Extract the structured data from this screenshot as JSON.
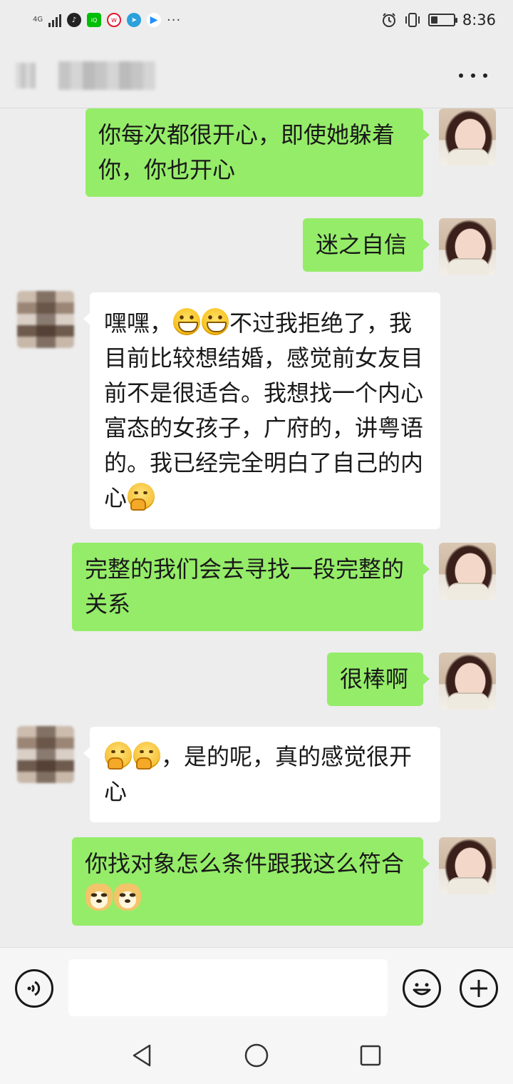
{
  "status_bar": {
    "network": "4G",
    "time": "8:36",
    "battery_level": 0.3,
    "app_icons": [
      "tiktok-icon",
      "iqiyi-icon",
      "weibo-icon",
      "telegram-icon",
      "youku-icon"
    ],
    "more": "···"
  },
  "header": {
    "title": "",
    "more_icon": "more-dots-icon"
  },
  "messages": [
    {
      "side": "me",
      "text": "你每次都很开心，即使她躲着你，你也开心"
    },
    {
      "side": "me",
      "text": "迷之自信"
    },
    {
      "side": "friend",
      "text_before": "嘿嘿，",
      "emoji": [
        "grin",
        "grin"
      ],
      "text_after": "不过我拒绝了，我目前比较想结婚，感觉前女友目前不是很适合。我想找一个内心富态的女孩子，广府的，讲粤语的。我已经完全明白了自己的内心",
      "trailing_emoji": "think"
    },
    {
      "side": "me",
      "text": "完整的我们会去寻找一段完整的关系"
    },
    {
      "side": "me",
      "text": "很棒啊"
    },
    {
      "side": "friend",
      "emoji": [
        "think",
        "think"
      ],
      "text_after": "，是的呢，真的感觉很开心"
    },
    {
      "side": "me",
      "text": "你找对象怎么条件跟我这么符合",
      "trailing_emoji": [
        "doge",
        "doge"
      ]
    }
  ],
  "input_bar": {
    "value": "",
    "voice_icon": "voice-icon",
    "emoji_icon": "emoji-icon",
    "plus_icon": "plus-icon"
  },
  "nav_bar": {
    "back_icon": "back-triangle-icon",
    "home_icon": "home-circle-icon",
    "recent_icon": "recent-square-icon"
  },
  "colors": {
    "background": "#ededed",
    "my_bubble": "#95ec69",
    "friend_bubble": "#ffffff"
  }
}
